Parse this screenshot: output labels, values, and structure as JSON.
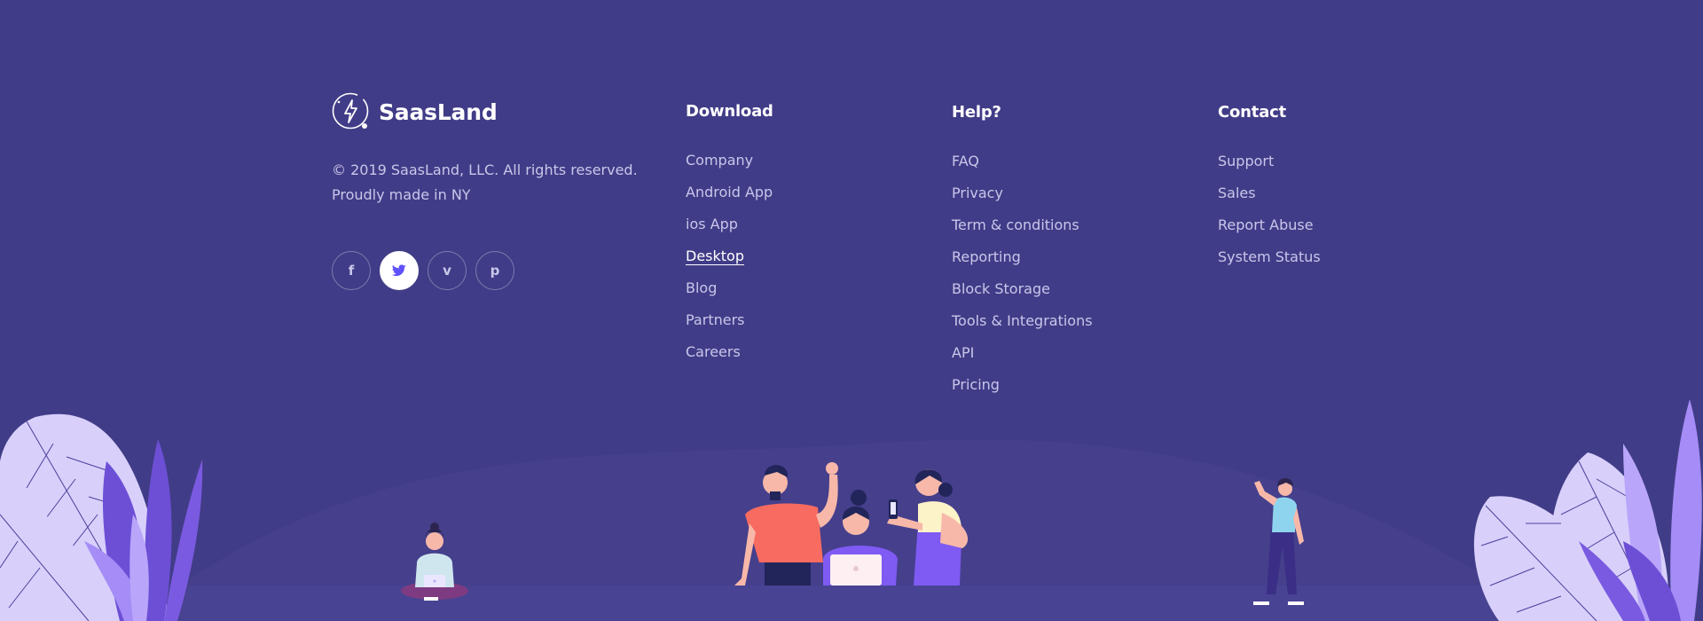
{
  "colors": {
    "background": "#413c87",
    "ground": "#484392",
    "heading": "#ffffff",
    "link": "#c9c6ea",
    "twitter_accent": "#5f51fb"
  },
  "brand": {
    "name": "SaasLand",
    "logo_icon": "lightning-bolt-circle-icon",
    "copyright": "© 2019 SaasLand, LLC. All rights reserved.",
    "tagline": "Proudly made in NY"
  },
  "social": [
    {
      "icon": "facebook-icon",
      "glyph": "f",
      "active": false
    },
    {
      "icon": "twitter-icon",
      "glyph": "",
      "active": true
    },
    {
      "icon": "vimeo-icon",
      "glyph": "v",
      "active": false
    },
    {
      "icon": "pinterest-icon",
      "glyph": "p",
      "active": false
    }
  ],
  "columns": {
    "download": {
      "title": "Download",
      "links": [
        "Company",
        "Android App",
        "ios App",
        "Desktop",
        "Blog",
        "Partners",
        "Careers"
      ],
      "current": "Desktop"
    },
    "help": {
      "title": "Help?",
      "links": [
        "FAQ",
        "Privacy",
        "Term & conditions",
        "Reporting",
        "Block Storage",
        "Tools & Integrations",
        "API",
        "Pricing"
      ]
    },
    "contact": {
      "title": "Contact",
      "links": [
        "Support",
        "Sales",
        "Report Abuse",
        "System Status"
      ]
    }
  }
}
